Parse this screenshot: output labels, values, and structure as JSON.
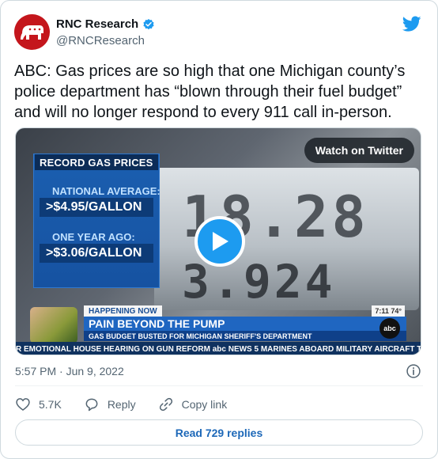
{
  "author": {
    "display_name": "RNC Research",
    "handle": "@RNCResearch",
    "verified": true
  },
  "tweet": {
    "text": "ABC: Gas prices are so high that one Michigan county’s police department has “blown through their fuel budget” and will no longer respond to every 911 call in-person."
  },
  "media": {
    "watch_label": "Watch on Twitter",
    "graphic": {
      "header": "RECORD GAS PRICES",
      "label1": "NATIONAL AVERAGE:",
      "value1": ">$4.95/GALLON",
      "label2": "ONE YEAR AGO:",
      "value2": ">$3.06/GALLON"
    },
    "pump_digits_top": "18.28",
    "pump_digits_bottom": "3.924",
    "lower_third": {
      "tag": "HAPPENING NOW",
      "time": "7:11 74°",
      "headline": "PAIN BEYOND THE PUMP",
      "subhead": "GAS BUDGET BUSTED FOR MICHIGAN SHERIFF'S DEPARTMENT",
      "logo": "abc",
      "ticker": "R EMOTIONAL HOUSE HEARING ON GUN REFORM   abc NEWS   5 MARINES ABOARD MILITARY AIRCRAFT THA"
    }
  },
  "meta": {
    "timestamp": "5:57 PM · Jun 9, 2022"
  },
  "actions": {
    "like_count": "5.7K",
    "reply_label": "Reply",
    "copy_label": "Copy link"
  },
  "replies_button": "Read 729 replies",
  "colors": {
    "accent": "#1d9bf0",
    "avatar_bg": "#c4161c",
    "text_secondary": "#536471"
  }
}
